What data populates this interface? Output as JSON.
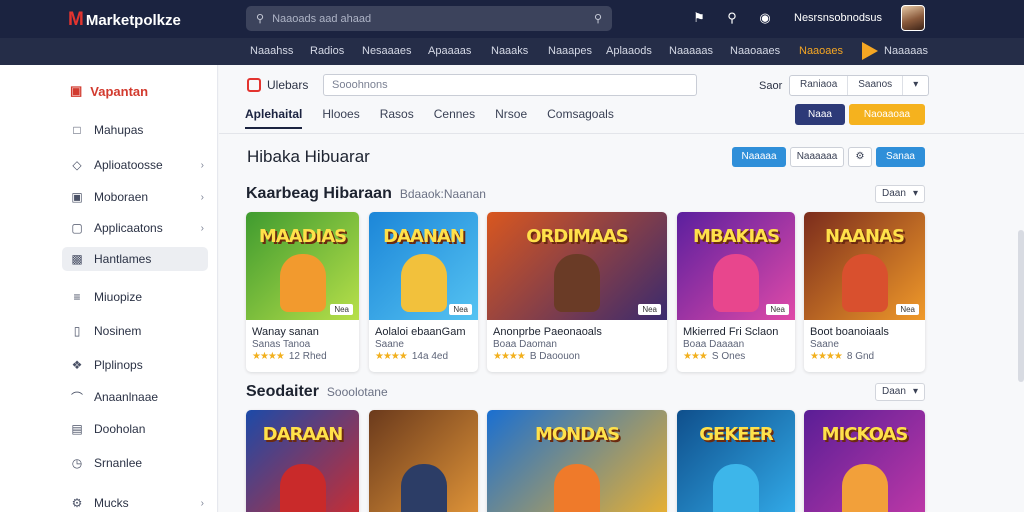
{
  "app": {
    "brand_mark": "M",
    "brand_name": "Marketpolkze"
  },
  "search": {
    "placeholder": "Naaoads aad ahaad"
  },
  "header": {
    "user_name": "Nesrsnsobnodsus"
  },
  "nav": [
    "Naaahss",
    "Radios",
    "Nesaaaes",
    "Apaaaas",
    "Naaaks",
    "Naaapes",
    "Aplaaods",
    "Naaaaas",
    "Naaoaaes",
    "Naaoaes",
    "Naaaaas"
  ],
  "sidebar": {
    "brand": "Vapantan",
    "items": [
      {
        "label": "Mahupas",
        "icon": "document-icon",
        "chevron": false
      },
      {
        "label": "Aplioatoosse",
        "icon": "diamond-icon",
        "chevron": true
      },
      {
        "label": "Moboraen",
        "icon": "image-icon",
        "chevron": true
      },
      {
        "label": "Applicaatons",
        "icon": "window-icon",
        "chevron": true
      },
      {
        "label": "Hantlames",
        "icon": "gamepad-icon",
        "chevron": false,
        "active": true
      },
      {
        "label": "Miuopize",
        "icon": "list-icon",
        "chevron": false
      },
      {
        "label": "Nosinem",
        "icon": "book-icon",
        "chevron": false
      },
      {
        "label": "Plplinops",
        "icon": "puzzle-icon",
        "chevron": false
      },
      {
        "label": "Anaanlnaae",
        "icon": "headset-icon",
        "chevron": false
      },
      {
        "label": "Dooholan",
        "icon": "folder-icon",
        "chevron": false
      },
      {
        "label": "Srnanlee",
        "icon": "clock-icon",
        "chevron": false
      },
      {
        "label": "Mucks",
        "icon": "gear-icon",
        "chevron": true
      }
    ]
  },
  "toolbar": {
    "sub_brand": "Ulebars",
    "search_value": "Sooohnons",
    "sort_label": "Saor",
    "segments": [
      "Raniaoa",
      "Saanos"
    ],
    "tabs": [
      "Aplehaital",
      "Hlooes",
      "Rasos",
      "Cennes",
      "Nrsoe",
      "Comsagoals"
    ],
    "btn_navy": "Naaa",
    "btn_amber": "Naoaaoaa"
  },
  "page": {
    "title": "Hibaka Hibuarar",
    "buttons": [
      "Naaaaa",
      "Naaaaaa",
      "Sanaa"
    ]
  },
  "sections": [
    {
      "title": "Kaarbeag Hibaraan",
      "subtitle": "Bdaaok:Naanan",
      "select": "Daan",
      "cards": [
        {
          "badge": "MAADIAS",
          "name": "Wanay sanan",
          "meta": "Sanas Tanoa",
          "rating": "★★★★",
          "rating_extra": "12 Rhed",
          "tag": "Nea",
          "art": "#3f9b2f",
          "art2": "#b8e04a",
          "char": "#f29a2e"
        },
        {
          "badge": "DAANAN",
          "name": "Aolaloi ebaanGam",
          "meta": "Saane",
          "rating": "★★★★",
          "rating_extra": "14a 4ed",
          "tag": "Nea",
          "art": "#1c86d8",
          "art2": "#55c3f2",
          "char": "#f2c13c"
        },
        {
          "badge": "ORDIMAAS",
          "name": "Anonprbe Paeonaoals",
          "meta": "Boaa Daoman",
          "rating": "★★★★",
          "rating_extra": "B Daoouon",
          "tag": "Nea",
          "art": "#d9571f",
          "art2": "#3a2a6e",
          "char": "#6a3b26"
        },
        {
          "badge": "MBAKIAS",
          "name": "Mkierred Fri Sclaon",
          "meta": "Boaa Daaaan",
          "rating": "★★★",
          "rating_extra": "S Ones",
          "tag": "Nea",
          "art": "#5b1f9e",
          "art2": "#e04aa8",
          "char": "#e8468d"
        },
        {
          "badge": "NAANAS",
          "name": "Boot boanoiaals",
          "meta": "Saane",
          "rating": "★★★★",
          "rating_extra": "8 Gnd",
          "tag": "Nea",
          "art": "#7b2c1c",
          "art2": "#f09a2a",
          "char": "#d9502e"
        }
      ]
    },
    {
      "title": "Seodaiter",
      "subtitle": "Sooolotane",
      "select": "Daan",
      "cards": [
        {
          "badge": "DARAAN",
          "name": "",
          "meta": "",
          "rating": "",
          "rating_extra": "",
          "tag": "",
          "art": "#1c4aa8",
          "art2": "#d32b2b",
          "char": "#c92a2a"
        },
        {
          "badge": "",
          "name": "",
          "meta": "",
          "rating": "",
          "rating_extra": "",
          "tag": "",
          "art": "#6b3a1c",
          "art2": "#e79a3a",
          "char": "#2c3d66"
        },
        {
          "badge": "MONDAS",
          "name": "",
          "meta": "",
          "rating": "",
          "rating_extra": "",
          "tag": "",
          "art": "#1a6fd1",
          "art2": "#f2b32a",
          "char": "#ef7a2a"
        },
        {
          "badge": "GEKEER",
          "name": "",
          "meta": "",
          "rating": "",
          "rating_extra": "",
          "tag": "",
          "art": "#0f4f8c",
          "art2": "#34b0ee",
          "char": "#3db6ea"
        },
        {
          "badge": "MICKOAS",
          "name": "",
          "meta": "",
          "rating": "",
          "rating_extra": "",
          "tag": "",
          "art": "#5a1e96",
          "art2": "#c43aa8",
          "char": "#f2a03a"
        }
      ]
    }
  ]
}
